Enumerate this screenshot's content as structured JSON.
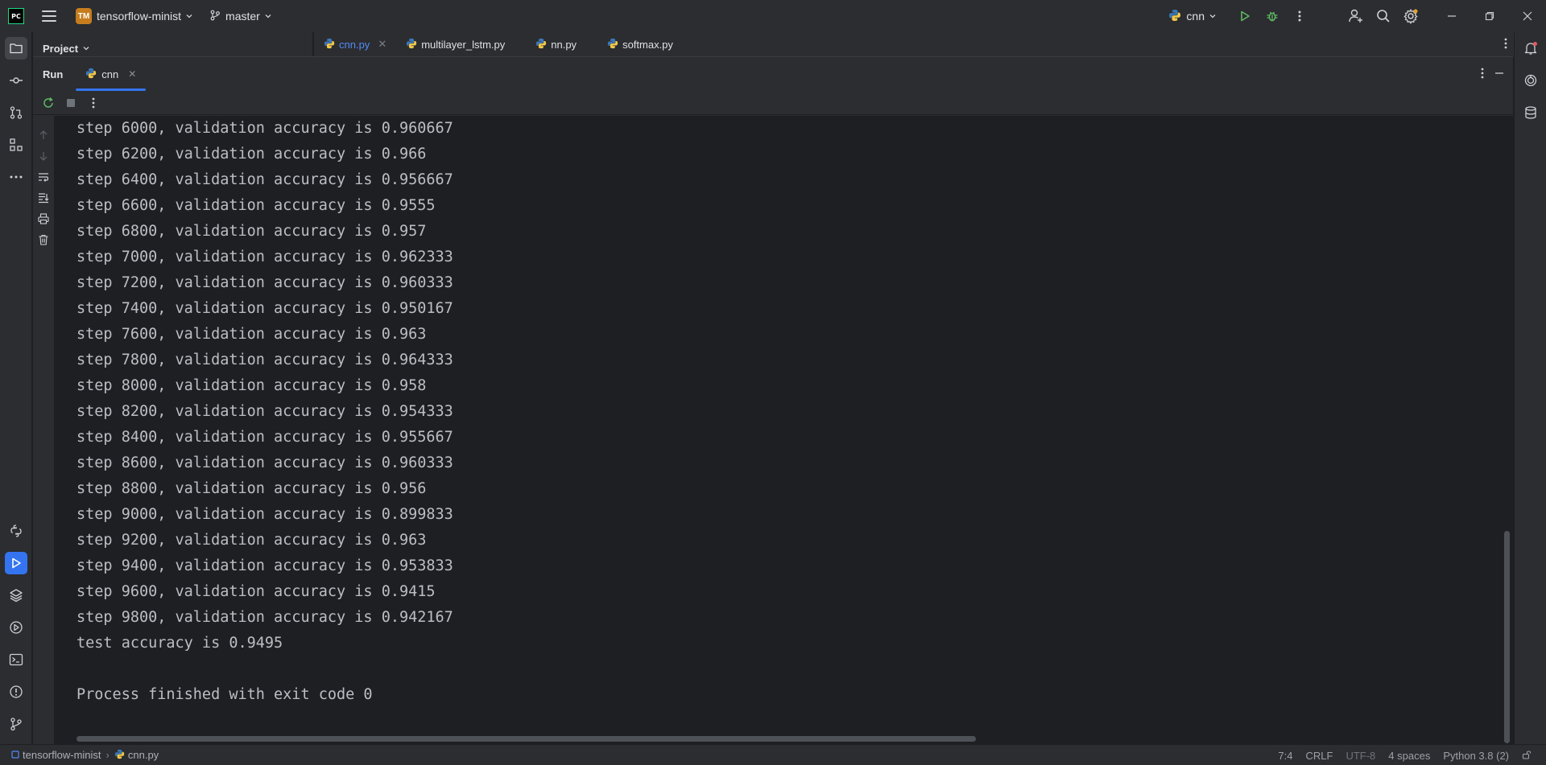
{
  "titlebar": {
    "logo_text": "PC",
    "project_badge": "TM",
    "project_name": "tensorflow-minist",
    "branch": "master",
    "run_config": "cnn"
  },
  "project_panel": {
    "label": "Project"
  },
  "editor_tabs": [
    {
      "label": "cnn.py",
      "active": true
    },
    {
      "label": "multilayer_lstm.py",
      "active": false
    },
    {
      "label": "nn.py",
      "active": false
    },
    {
      "label": "softmax.py",
      "active": false
    }
  ],
  "run": {
    "label": "Run",
    "tab_label": "cnn"
  },
  "console": {
    "lines": [
      "step 6000, validation accuracy is 0.960667",
      "step 6200, validation accuracy is 0.966",
      "step 6400, validation accuracy is 0.956667",
      "step 6600, validation accuracy is 0.9555",
      "step 6800, validation accuracy is 0.957",
      "step 7000, validation accuracy is 0.962333",
      "step 7200, validation accuracy is 0.960333",
      "step 7400, validation accuracy is 0.950167",
      "step 7600, validation accuracy is 0.963",
      "step 7800, validation accuracy is 0.964333",
      "step 8000, validation accuracy is 0.958",
      "step 8200, validation accuracy is 0.954333",
      "step 8400, validation accuracy is 0.955667",
      "step 8600, validation accuracy is 0.960333",
      "step 8800, validation accuracy is 0.956",
      "step 9000, validation accuracy is 0.899833",
      "step 9200, validation accuracy is 0.963",
      "step 9400, validation accuracy is 0.953833",
      "step 9600, validation accuracy is 0.9415",
      "step 9800, validation accuracy is 0.942167",
      "test accuracy is 0.9495",
      "",
      "Process finished with exit code 0"
    ]
  },
  "statusbar": {
    "project": "tensorflow-minist",
    "file": "cnn.py",
    "position": "7:4",
    "line_ending": "CRLF",
    "encoding": "UTF-8",
    "indent": "4 spaces",
    "interpreter": "Python 3.8 (2)"
  },
  "colors": {
    "accent": "#3574f0",
    "run_green": "#5fb865",
    "debug_green": "#5fb865",
    "project_badge": "#c77d1e"
  }
}
